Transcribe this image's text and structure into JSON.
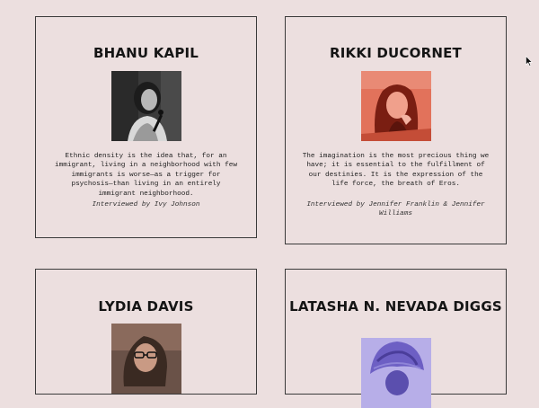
{
  "cards": [
    {
      "name": "BHANU KAPIL",
      "quote": "Ethnic density is the idea that, for an immigrant, living in a neighborhood with few immigrants is worse—as a trigger for psychosis—than living in an entirely immigrant neighborhood.",
      "credit": "Interviewed by Ivy Johnson",
      "photo_icon": "portrait-photo-icon"
    },
    {
      "name": "RIKKI DUCORNET",
      "quote": "The imagination is the most precious thing we have; it is essential to the fulfillment of our destinies. It is the expression of the life force, the breath of Eros.",
      "credit": "Interviewed by Jennifer Franklin & Jennifer Williams",
      "photo_icon": "portrait-photo-icon"
    },
    {
      "name": "LYDIA DAVIS",
      "photo_icon": "portrait-photo-icon"
    },
    {
      "name": "LATASHA N. NEVADA DIGGS",
      "photo_icon": "portrait-photo-icon"
    }
  ],
  "colors": {
    "background": "#ecdfdf",
    "border": "#3a3a3a",
    "ducornet_tint": "#e2725b",
    "diggs_tint": "#8a7fd8"
  }
}
